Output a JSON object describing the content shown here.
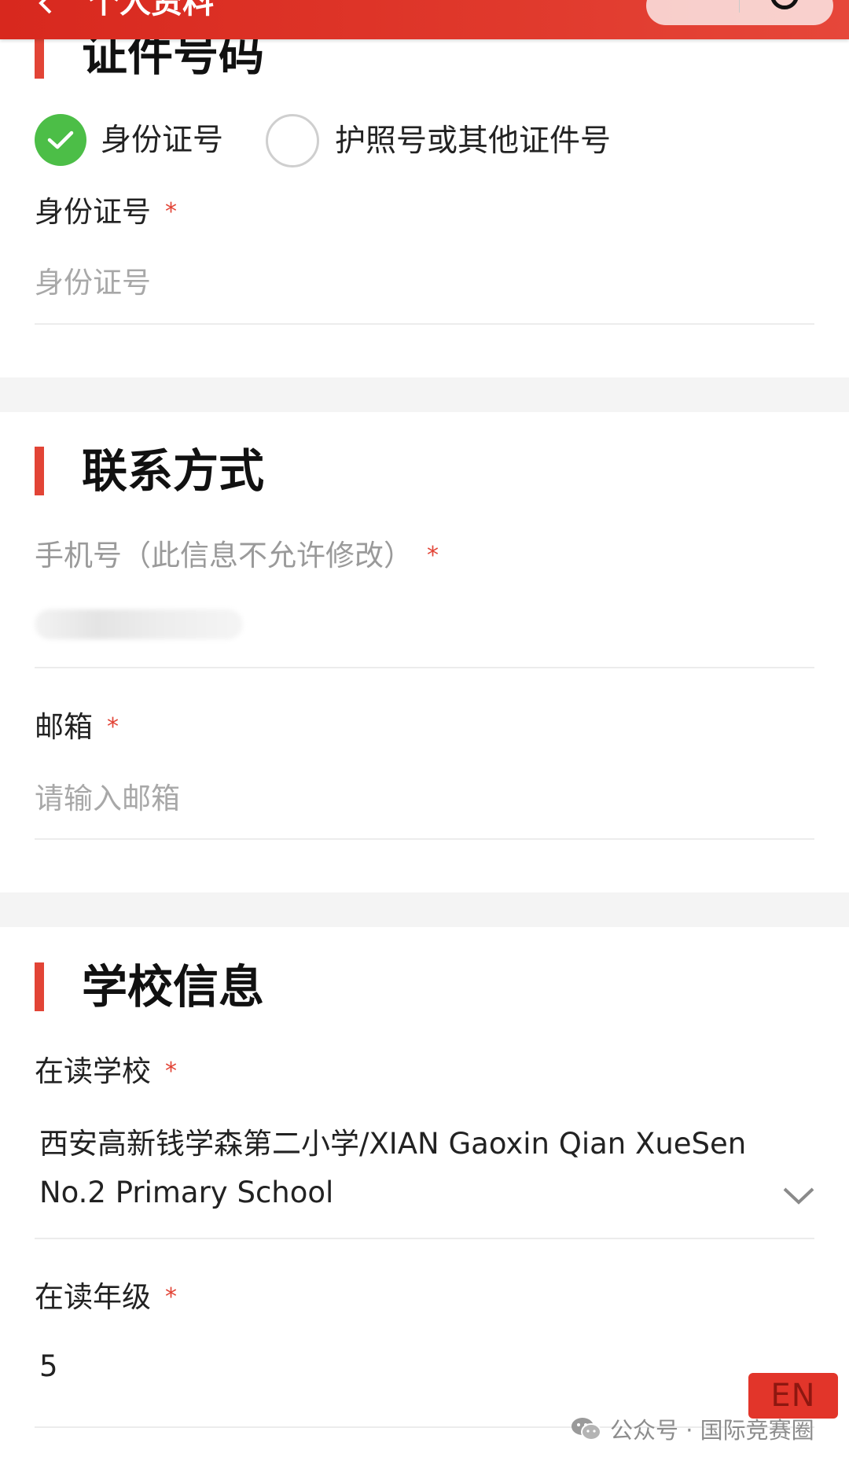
{
  "header": {
    "title": "个人资料",
    "back_icon": "chevron-left-icon"
  },
  "id_section": {
    "title": "证件号码",
    "radio_options": [
      "身份证号",
      "护照号或其他证件号"
    ],
    "selected_option": "身份证号",
    "field_label": "身份证号",
    "required_mark": "*",
    "field_placeholder": "身份证号",
    "field_value": ""
  },
  "contact_section": {
    "title": "联系方式",
    "phone_label": "手机号（此信息不允许修改）",
    "phone_value_state": "blurred",
    "email_label": "邮箱",
    "email_placeholder": "请输入邮箱",
    "email_value": ""
  },
  "school_section": {
    "title": "学校信息",
    "school_label": "在读学校",
    "school_value": "西安高新钱学森第二小学/XIAN Gaoxin Qian XueSen No.2 Primary School",
    "grade_label": "在读年级",
    "grade_value": "5"
  },
  "overlay": {
    "lang_button": "EN",
    "watermark": "公众号 · 国际竞赛圈"
  },
  "colors": {
    "header_red": "#d8281e",
    "accent_red": "#e24436",
    "check_green": "#4cbe47",
    "section_gap_gray": "#f4f4f4"
  }
}
